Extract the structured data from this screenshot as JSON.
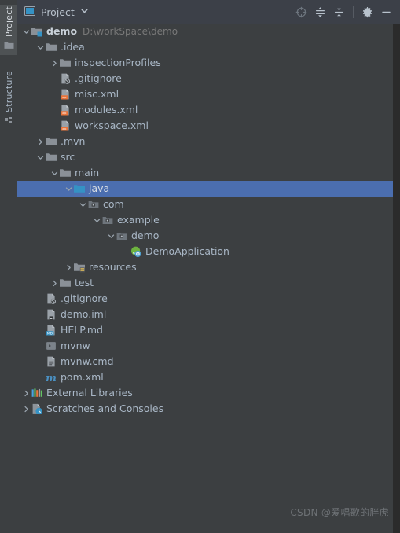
{
  "toolwindow": {
    "tabs": [
      {
        "label": "Project",
        "icon": "folder-icon",
        "active": true
      },
      {
        "label": "Structure",
        "icon": "structure-icon",
        "active": false
      }
    ]
  },
  "header": {
    "icon": "project-window-icon",
    "title": "Project",
    "dropdown_icon": "chevron-down-icon",
    "buttons": [
      {
        "name": "select-opened-file-button",
        "icon": "crosshair-icon",
        "label": "Select Opened File"
      },
      {
        "name": "expand-all-button",
        "icon": "expand-all-icon",
        "label": "Expand All"
      },
      {
        "name": "collapse-all-button",
        "icon": "collapse-all-icon",
        "label": "Collapse All"
      },
      {
        "name": "settings-button",
        "icon": "gear-icon",
        "label": "Options"
      },
      {
        "name": "hide-button",
        "icon": "minimize-icon",
        "label": "Hide"
      }
    ]
  },
  "colors": {
    "background": "#3c3f41",
    "header_background": "#3c4048",
    "selection": "#4b6eaf",
    "text": "#a9b7c6",
    "muted_text": "#787878",
    "folder": "#8a9097",
    "source_folder": "#3592c4",
    "xml_badge": "#e8743b",
    "md_badge": "#3592c4",
    "maven": "#4a90c2",
    "spring": "#6db33f"
  },
  "tree": {
    "nodes": [
      {
        "label": "demo",
        "path": "D:\\workSpace\\demo",
        "depth": 0,
        "arrow": "expanded",
        "icon": "module-folder-icon",
        "bold": true,
        "selected": false
      },
      {
        "label": ".idea",
        "path": "",
        "depth": 1,
        "arrow": "expanded",
        "icon": "folder-icon",
        "bold": false,
        "selected": false
      },
      {
        "label": "inspectionProfiles",
        "path": "",
        "depth": 2,
        "arrow": "collapsed",
        "icon": "folder-icon",
        "bold": false,
        "selected": false
      },
      {
        "label": ".gitignore",
        "path": "",
        "depth": 2,
        "arrow": "none",
        "icon": "gitignore-file-icon",
        "bold": false,
        "selected": false
      },
      {
        "label": "misc.xml",
        "path": "",
        "depth": 2,
        "arrow": "none",
        "icon": "xml-file-icon",
        "bold": false,
        "selected": false
      },
      {
        "label": "modules.xml",
        "path": "",
        "depth": 2,
        "arrow": "none",
        "icon": "xml-file-icon",
        "bold": false,
        "selected": false
      },
      {
        "label": "workspace.xml",
        "path": "",
        "depth": 2,
        "arrow": "none",
        "icon": "xml-file-icon",
        "bold": false,
        "selected": false
      },
      {
        "label": ".mvn",
        "path": "",
        "depth": 1,
        "arrow": "collapsed",
        "icon": "folder-icon",
        "bold": false,
        "selected": false
      },
      {
        "label": "src",
        "path": "",
        "depth": 1,
        "arrow": "expanded",
        "icon": "folder-icon",
        "bold": false,
        "selected": false
      },
      {
        "label": "main",
        "path": "",
        "depth": 2,
        "arrow": "expanded",
        "icon": "folder-icon",
        "bold": false,
        "selected": false
      },
      {
        "label": "java",
        "path": "",
        "depth": 3,
        "arrow": "expanded",
        "icon": "source-folder-icon",
        "bold": false,
        "selected": true
      },
      {
        "label": "com",
        "path": "",
        "depth": 4,
        "arrow": "expanded",
        "icon": "package-icon",
        "bold": false,
        "selected": false
      },
      {
        "label": "example",
        "path": "",
        "depth": 5,
        "arrow": "expanded",
        "icon": "package-icon",
        "bold": false,
        "selected": false
      },
      {
        "label": "demo",
        "path": "",
        "depth": 6,
        "arrow": "expanded",
        "icon": "package-icon",
        "bold": false,
        "selected": false
      },
      {
        "label": "DemoApplication",
        "path": "",
        "depth": 7,
        "arrow": "none",
        "icon": "spring-boot-class-icon",
        "bold": false,
        "selected": false
      },
      {
        "label": "resources",
        "path": "",
        "depth": 3,
        "arrow": "collapsed",
        "icon": "resources-folder-icon",
        "bold": false,
        "selected": false
      },
      {
        "label": "test",
        "path": "",
        "depth": 2,
        "arrow": "collapsed",
        "icon": "folder-icon",
        "bold": false,
        "selected": false
      },
      {
        "label": ".gitignore",
        "path": "",
        "depth": 1,
        "arrow": "none",
        "icon": "gitignore-file-icon",
        "bold": false,
        "selected": false
      },
      {
        "label": "demo.iml",
        "path": "",
        "depth": 1,
        "arrow": "none",
        "icon": "iml-file-icon",
        "bold": false,
        "selected": false
      },
      {
        "label": "HELP.md",
        "path": "",
        "depth": 1,
        "arrow": "none",
        "icon": "markdown-file-icon",
        "bold": false,
        "selected": false
      },
      {
        "label": "mvnw",
        "path": "",
        "depth": 1,
        "arrow": "none",
        "icon": "shell-script-icon",
        "bold": false,
        "selected": false
      },
      {
        "label": "mvnw.cmd",
        "path": "",
        "depth": 1,
        "arrow": "none",
        "icon": "cmd-file-icon",
        "bold": false,
        "selected": false
      },
      {
        "label": "pom.xml",
        "path": "",
        "depth": 1,
        "arrow": "none",
        "icon": "maven-pom-icon",
        "bold": false,
        "selected": false
      },
      {
        "label": "External Libraries",
        "path": "",
        "depth": 0,
        "arrow": "collapsed",
        "icon": "libraries-icon",
        "bold": false,
        "selected": false
      },
      {
        "label": "Scratches and Consoles",
        "path": "",
        "depth": 0,
        "arrow": "collapsed",
        "icon": "scratches-icon",
        "bold": false,
        "selected": false
      }
    ]
  },
  "watermark": {
    "text": "CSDN @爱唱歌的胖虎"
  }
}
